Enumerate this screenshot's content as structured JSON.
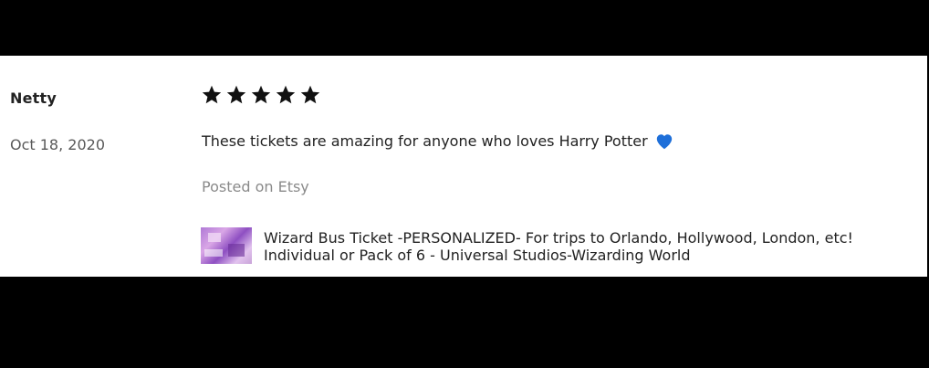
{
  "review": {
    "reviewer_name": "Netty",
    "date": "Oct 18, 2020",
    "rating": 5,
    "rating_max": 5,
    "star_icon": "star-icon",
    "text": "These tickets are amazing for anyone who loves Harry Potter",
    "text_emoji": "blue-heart-icon",
    "posted_on": "Posted on Etsy"
  },
  "listing": {
    "title_line1": "Wizard Bus Ticket -PERSONALIZED- For trips to Orlando, Hollywood, London, etc!",
    "title_line2": "Individual or Pack of 6 - Universal Studios-Wizarding World"
  },
  "colors": {
    "background": "#000000",
    "card": "#ffffff",
    "text": "#222222",
    "muted": "#8a8a8a",
    "heart": "#1e6fd9"
  }
}
